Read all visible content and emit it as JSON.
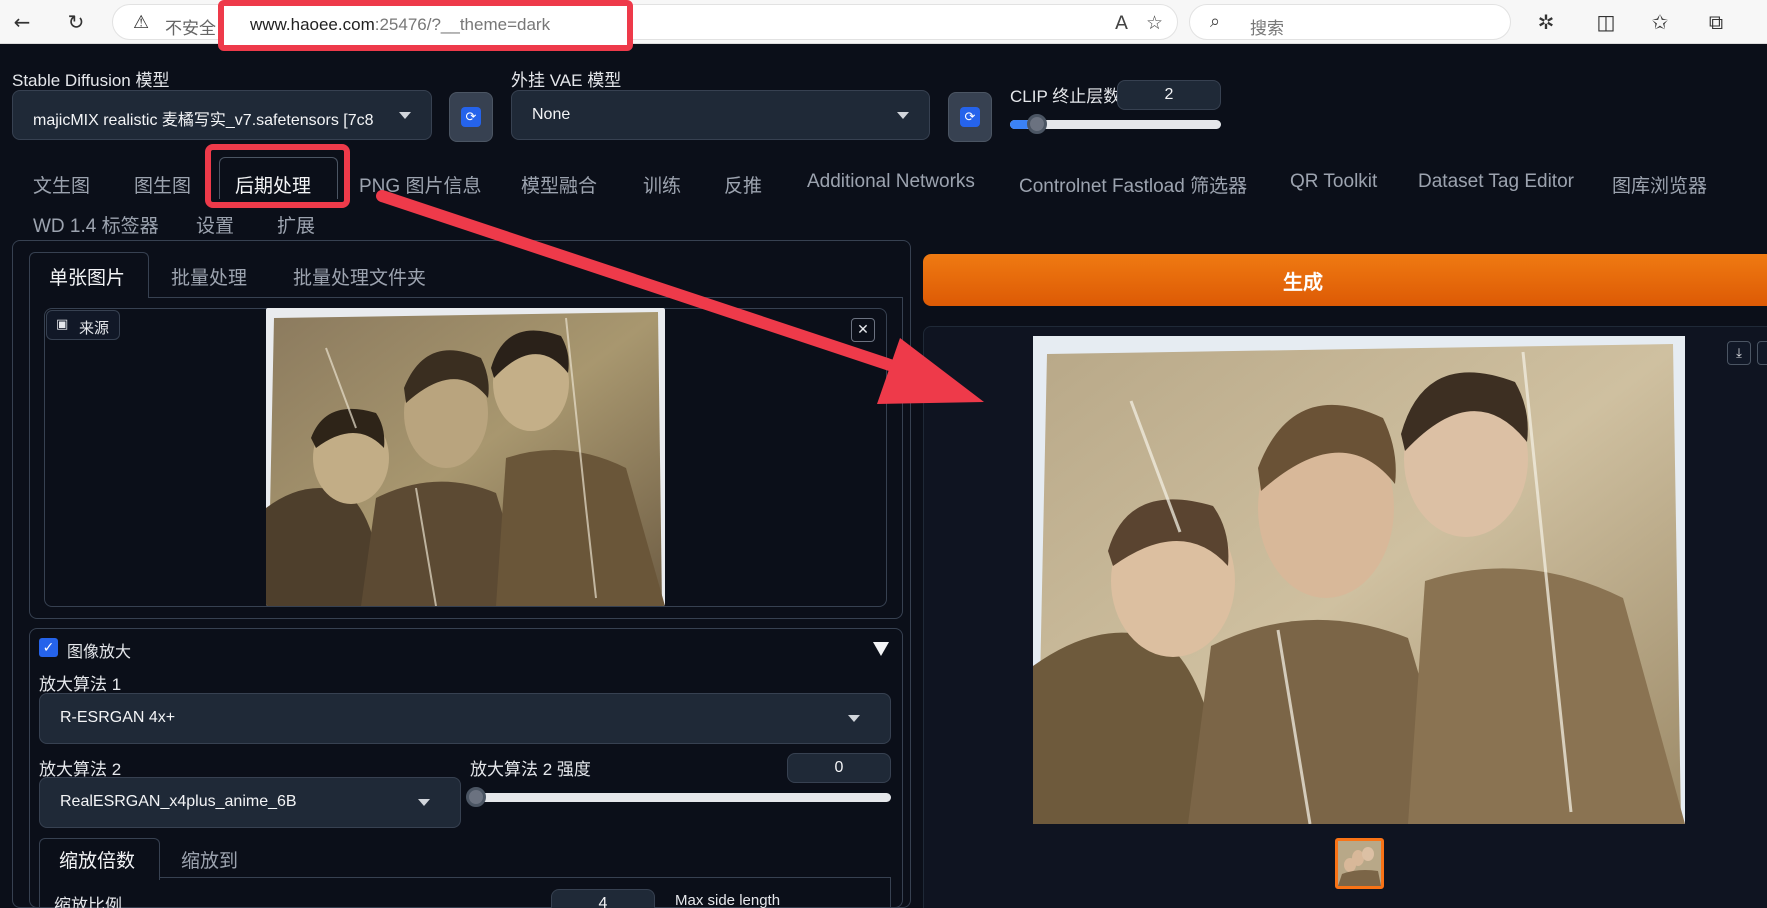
{
  "browser": {
    "insecure_label": "不安全",
    "url_host": "www.haoee.com",
    "url_rest": ":25476/?__theme=dark",
    "search_placeholder": "搜索"
  },
  "settings": {
    "sd_model_label": "Stable Diffusion 模型",
    "sd_model_value": "majicMIX realistic 麦橘写实_v7.safetensors [7c8",
    "vae_label": "外挂 VAE 模型",
    "vae_value": "None",
    "clip_label": "CLIP 终止层数",
    "clip_value": "2",
    "clip_slider_fraction": 0.1
  },
  "main_tabs": [
    "文生图",
    "图生图",
    "后期处理",
    "PNG 图片信息",
    "模型融合",
    "训练",
    "反推",
    "Additional Networks",
    "Controlnet Fastload 筛选器",
    "QR Toolkit",
    "Dataset Tag Editor",
    "图库浏览器",
    "WD 1.4 标签器",
    "设置",
    "扩展"
  ],
  "active_main_tab": "后期处理",
  "sub_tabs": [
    "单张图片",
    "批量处理",
    "批量处理文件夹"
  ],
  "source_label": "来源",
  "upscale": {
    "enabled_label": "图像放大",
    "algo1_label": "放大算法 1",
    "algo1_value": "R-ESRGAN 4x+",
    "algo2_label": "放大算法 2",
    "algo2_value": "RealESRGAN_x4plus_anime_6B",
    "algo2_strength_label": "放大算法 2 强度",
    "algo2_strength_value": "0",
    "strength_fraction": 0.0,
    "scale_tabs": [
      "缩放倍数",
      "缩放到"
    ],
    "scale_ratio_label": "缩放比例",
    "scale_ratio_value": "4",
    "max_side_label": "Max side length"
  },
  "generate_label": "生成",
  "colors": {
    "background": "#0b0f19",
    "accent_orange": "#ea6a0a",
    "highlight_red": "#ee3a4a",
    "checkbox_blue": "#2563eb"
  }
}
